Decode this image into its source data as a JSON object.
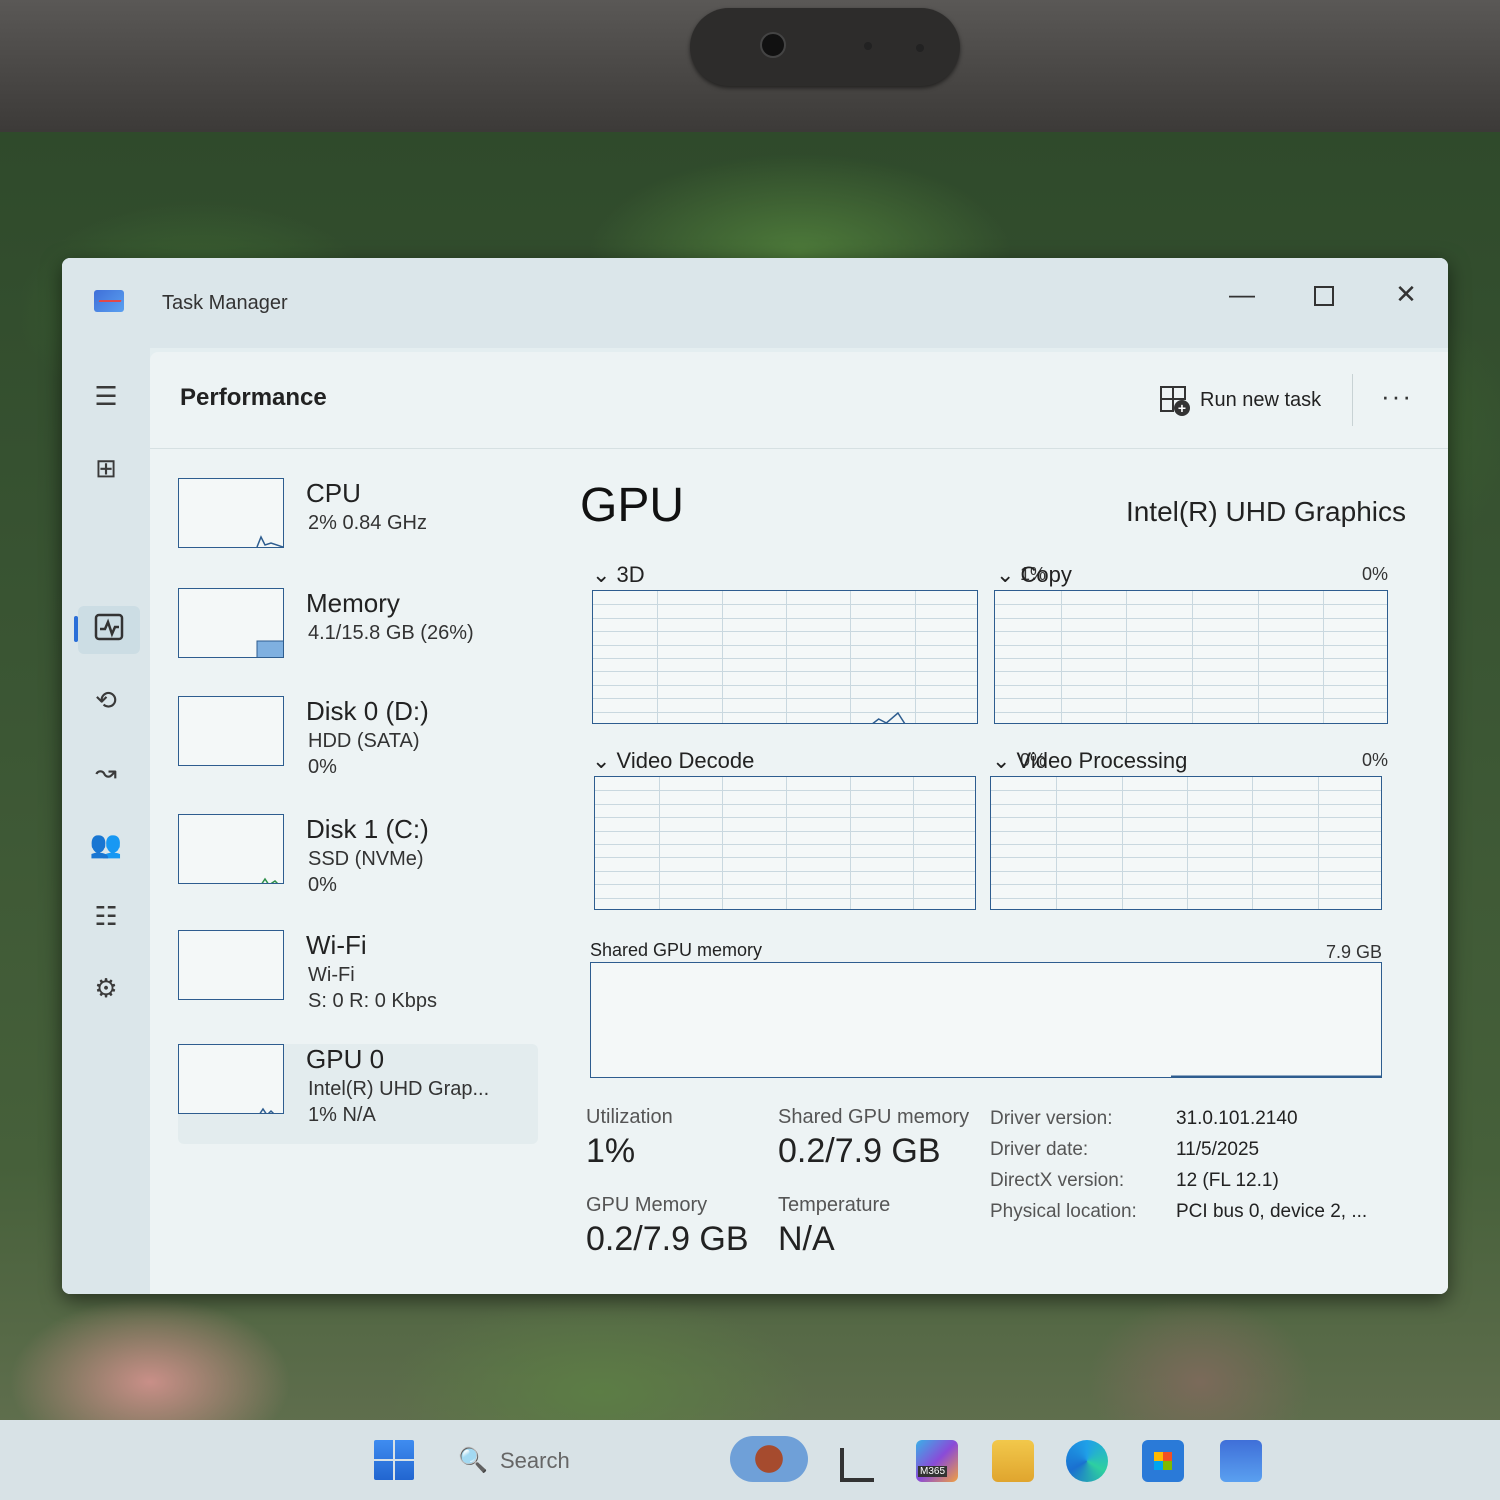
{
  "window": {
    "title": "Task Manager",
    "minimize_glyph": "—",
    "close_glyph": "✕"
  },
  "nav": {
    "items": [
      "menu-icon",
      "processes-icon",
      "performance-icon",
      "app-history-icon",
      "startup-apps-icon",
      "users-icon",
      "details-icon",
      "services-icon",
      "settings-icon"
    ],
    "active": "performance-icon"
  },
  "header": {
    "title": "Performance",
    "run_new_task": "Run new task",
    "more": "···"
  },
  "devices": [
    {
      "name": "CPU",
      "sub1": "2%  0.84 GHz",
      "sub2": ""
    },
    {
      "name": "Memory",
      "sub1": "4.1/15.8 GB (26%)",
      "sub2": ""
    },
    {
      "name": "Disk 0 (D:)",
      "sub1": "HDD (SATA)",
      "sub2": "0%"
    },
    {
      "name": "Disk 1 (C:)",
      "sub1": "SSD (NVMe)",
      "sub2": "0%"
    },
    {
      "name": "Wi-Fi",
      "sub1": "Wi-Fi",
      "sub2": "S: 0  R: 0 Kbps"
    },
    {
      "name": "GPU 0",
      "sub1": "Intel(R) UHD Grap...",
      "sub2": "1%  N/A"
    }
  ],
  "selected_device": "GPU 0",
  "gpu": {
    "title": "GPU",
    "model": "Intel(R) UHD Graphics",
    "charts": [
      {
        "label": "3D",
        "percent": "1%"
      },
      {
        "label": "Copy",
        "percent": "0%"
      },
      {
        "label": "Video Decode",
        "percent": "0%"
      },
      {
        "label": "Video Processing",
        "percent": "0%"
      }
    ],
    "shared_memory_chart": {
      "label": "Shared GPU memory",
      "max": "7.9 GB"
    },
    "stats": {
      "utilization_label": "Utilization",
      "utilization": "1%",
      "shared_gpu_memory_label": "Shared GPU memory",
      "shared_gpu_memory": "0.2/7.9 GB",
      "gpu_memory_label": "GPU Memory",
      "gpu_memory": "0.2/7.9 GB",
      "temperature_label": "Temperature",
      "temperature": "N/A"
    },
    "details": [
      {
        "key": "Driver version:",
        "value": "31.0.101.2140"
      },
      {
        "key": "Driver date:",
        "value": "11/5/2025"
      },
      {
        "key": "DirectX version:",
        "value": "12 (FL 12.1)"
      },
      {
        "key": "Physical location:",
        "value": "PCI bus 0, device 2, ..."
      }
    ]
  },
  "taskbar": {
    "search_placeholder": "Search",
    "m365_label": "M365",
    "icons": [
      "start-icon",
      "search-icon",
      "widgets-icon",
      "file-manager-icon",
      "m365-icon",
      "file-explorer-icon",
      "edge-icon",
      "store-icon",
      "task-manager-icon"
    ]
  },
  "colors": {
    "accent": "#2a6ed8",
    "chart_border": "#2e5d8f",
    "chart_bg": "#f4f8f8",
    "grid": "#c9d8df"
  }
}
